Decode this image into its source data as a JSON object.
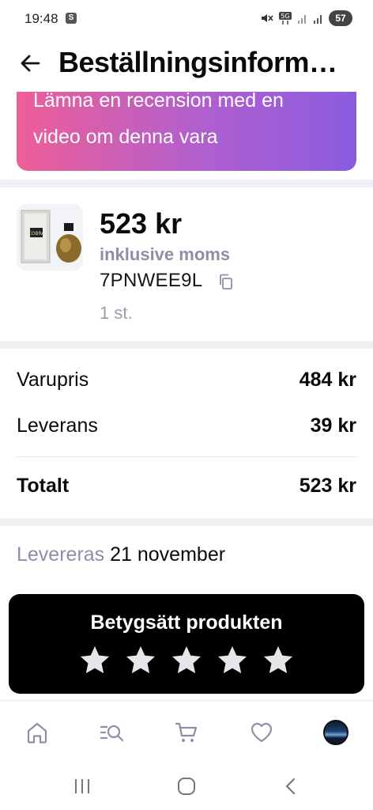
{
  "status_bar": {
    "time": "19:48",
    "s_badge": "S",
    "battery": "57"
  },
  "header": {
    "title": "Beställningsinformation"
  },
  "review_banner": {
    "text": "Lämna en recension med en video om denna vara"
  },
  "product": {
    "price": "523 kr",
    "tax_note": "inklusive moms",
    "code": "7PNWEE9L",
    "quantity": "1 st.",
    "image_label": "COBRA"
  },
  "summary": {
    "rows": [
      {
        "label": "Varupris",
        "value": "484 kr"
      },
      {
        "label": "Leverans",
        "value": "39 kr"
      }
    ],
    "total_label": "Totalt",
    "total_value": "523 kr"
  },
  "delivery": {
    "label": "Levereras",
    "date": "21 november"
  },
  "rating": {
    "title": "Betygsätt produkten",
    "stars": 5
  },
  "bottom_nav": [
    "home-icon",
    "search-list-icon",
    "cart-icon",
    "heart-icon",
    "profile-avatar"
  ],
  "colors": {
    "gradient_start": "#ee5f97",
    "gradient_end": "#8b5ce0",
    "muted_text": "#8d8fa8",
    "rate_card_bg": "#000000"
  }
}
